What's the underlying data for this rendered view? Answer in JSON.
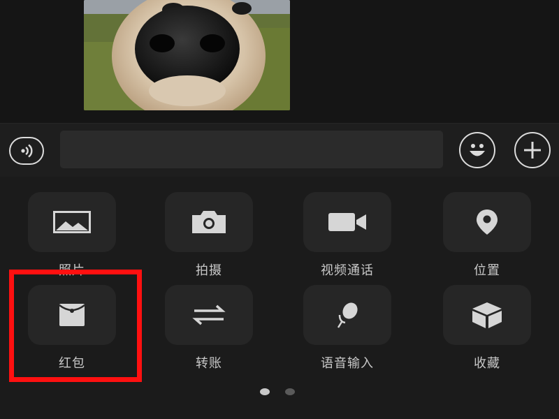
{
  "chat": {
    "photo_alt": "dog photo"
  },
  "input_bar": {
    "placeholder": "",
    "icons": [
      "voice-icon",
      "emoji-icon",
      "plus-icon"
    ]
  },
  "panel": {
    "items": [
      {
        "label": "照片",
        "icon": "image-icon"
      },
      {
        "label": "拍摄",
        "icon": "camera-icon"
      },
      {
        "label": "视频通话",
        "icon": "video-camera-icon"
      },
      {
        "label": "位置",
        "icon": "location-pin-icon"
      },
      {
        "label": "红包",
        "icon": "red-packet-icon"
      },
      {
        "label": "转账",
        "icon": "transfer-arrows-icon"
      },
      {
        "label": "语音输入",
        "icon": "microphone-icon"
      },
      {
        "label": "收藏",
        "icon": "cube-icon"
      }
    ],
    "page_count": 2,
    "current_page": 1
  },
  "colors": {
    "highlight": "#ff1010",
    "tile": "#262626",
    "icon": "#d6d6d6"
  }
}
